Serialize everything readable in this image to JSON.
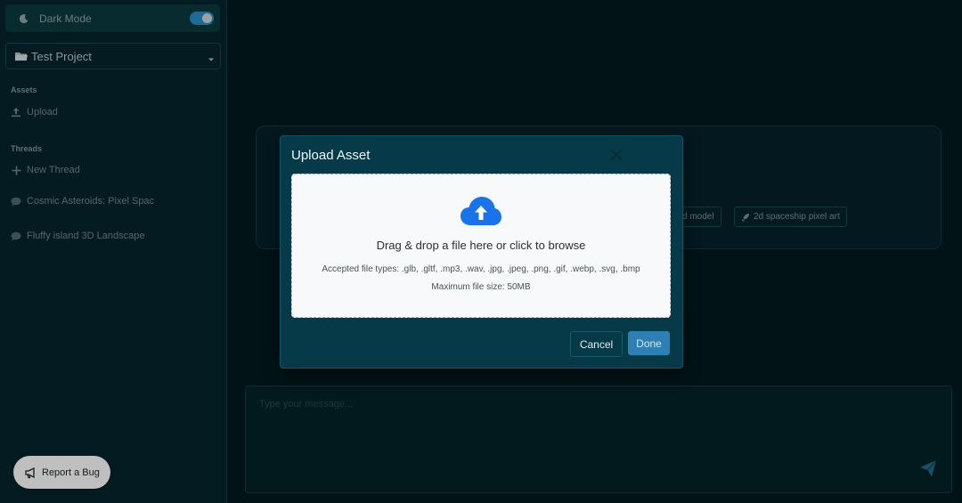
{
  "sidebar": {
    "dark_mode_label": "Dark Mode",
    "dark_mode_on": true,
    "project": "Test Project",
    "assets_heading": "Assets",
    "upload_label": "Upload",
    "threads_heading": "Threads",
    "new_thread_label": "New Thread",
    "threads": [
      {
        "label": "Cosmic Asteroids: Pixel Spac"
      },
      {
        "label": "Fluffy island 3D Landscape"
      }
    ],
    "report_bug_label": "Report a Bug"
  },
  "main": {
    "chips": [
      "d model",
      "2d spaceship pixel art"
    ],
    "chat_placeholder": "Type your message..."
  },
  "modal": {
    "title": "Upload Asset",
    "drop_text": "Drag & drop a file here or click to browse",
    "accepted_types": "Accepted file types: .glb, .gltf, .mp3, .wav, .jpg, .jpeg, .png, .gif, .webp, .svg, .bmp",
    "max_size": "Maximum file size: 50MB",
    "cancel_label": "Cancel",
    "done_label": "Done"
  },
  "colors": {
    "background": "#031a1f",
    "sidebar": "#06262c",
    "modal": "#063a48",
    "accent": "#2e7fb4",
    "cloud": "#1a73e8"
  },
  "icons": [
    "moon-icon",
    "folder-icon",
    "chevron-down-icon",
    "upload-icon",
    "plus-icon",
    "chat-bubble-icon",
    "megaphone-icon",
    "rocket-icon",
    "close-icon",
    "cloud-upload-icon",
    "send-icon"
  ]
}
